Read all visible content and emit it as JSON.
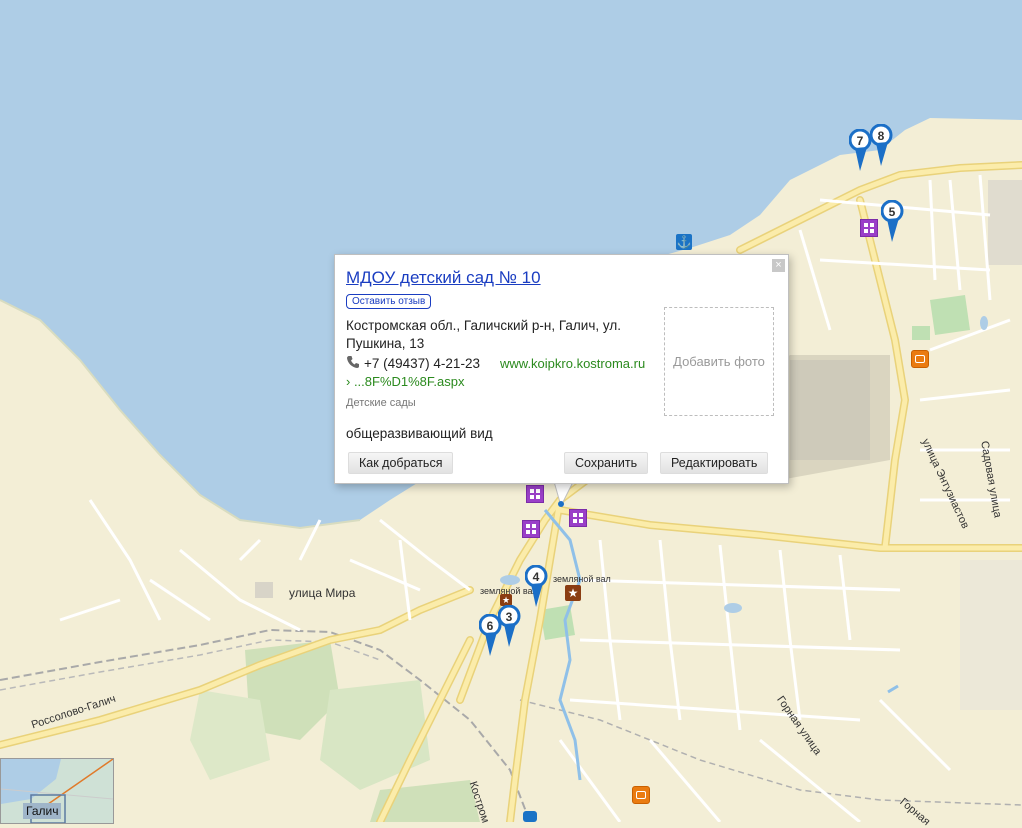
{
  "popup": {
    "title": "МДОУ детский сад № 10",
    "review_button": "Оставить отзыв",
    "address": "Костромская обл., Галичский р-н, Галич, ул. Пушкина, 13",
    "phone": "+7 (49437) 4-21-23",
    "website": "www.koipkro.kostroma.ru",
    "url_tail": "› ...8F%D1%8F.aspx",
    "category": "Детские сады",
    "kind": "общеразвивающий вид",
    "add_photo": "Добавить фото",
    "close_symbol": "×",
    "buttons": {
      "route": "Как добраться",
      "save": "Сохранить",
      "edit": "Редактировать"
    }
  },
  "map": {
    "street_labels": {
      "mira": "улица Мира",
      "rossolovo": "Россолово-Галич",
      "gornaya_street": "Горная улица",
      "gornaya": "Горная",
      "kostrom": "Костром",
      "entuziastov": "улица Энтузиастов",
      "sadovaya": "Садовая улица",
      "zemlyanoy_val": "земляной вал",
      "zemlyanoy_val_2": "земляной вал"
    },
    "markers": [
      "7",
      "8",
      "5",
      "4",
      "3",
      "6"
    ],
    "inset_label": "Галич",
    "icons": [
      "anchor-icon",
      "monument-star-icon",
      "kindergarten-icon",
      "shop-icon",
      "phone-icon",
      "close-icon"
    ]
  }
}
